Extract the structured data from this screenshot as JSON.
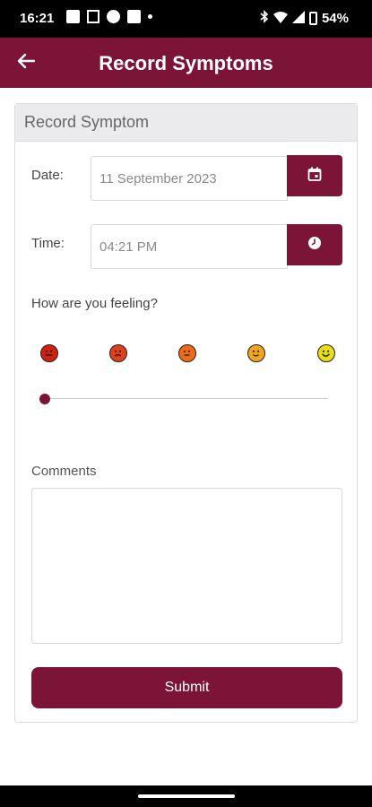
{
  "status_bar": {
    "time": "16:21",
    "battery": "54%",
    "icons": [
      "photo-icon",
      "sim-icon",
      "circle-icon",
      "square-icon",
      "dot-icon",
      "bluetooth-icon",
      "wifi-icon",
      "signal-icon",
      "battery-icon"
    ]
  },
  "app_bar": {
    "title": "Record Symptoms",
    "back_icon": "arrow-left-icon"
  },
  "form": {
    "header": "Record Symptom",
    "date_label": "Date:",
    "date_value": "11 September 2023",
    "date_icon": "calendar-icon",
    "time_label": "Time:",
    "time_value": "04:21 PM",
    "time_icon": "clock-icon",
    "feeling_label": "How are you feeling?",
    "feeling_scale": [
      "very-sad-face-icon",
      "sad-face-icon",
      "neutral-face-icon",
      "slight-smile-face-icon",
      "happy-face-icon"
    ],
    "feeling_slider_value": 0,
    "comments_label": "Comments",
    "comments_value": "",
    "submit_label": "Submit"
  },
  "colors": {
    "primary": "#7b1437",
    "emoji": [
      "#d0210e",
      "#e0401a",
      "#f06a16",
      "#f0a51c",
      "#e8dc14"
    ]
  }
}
